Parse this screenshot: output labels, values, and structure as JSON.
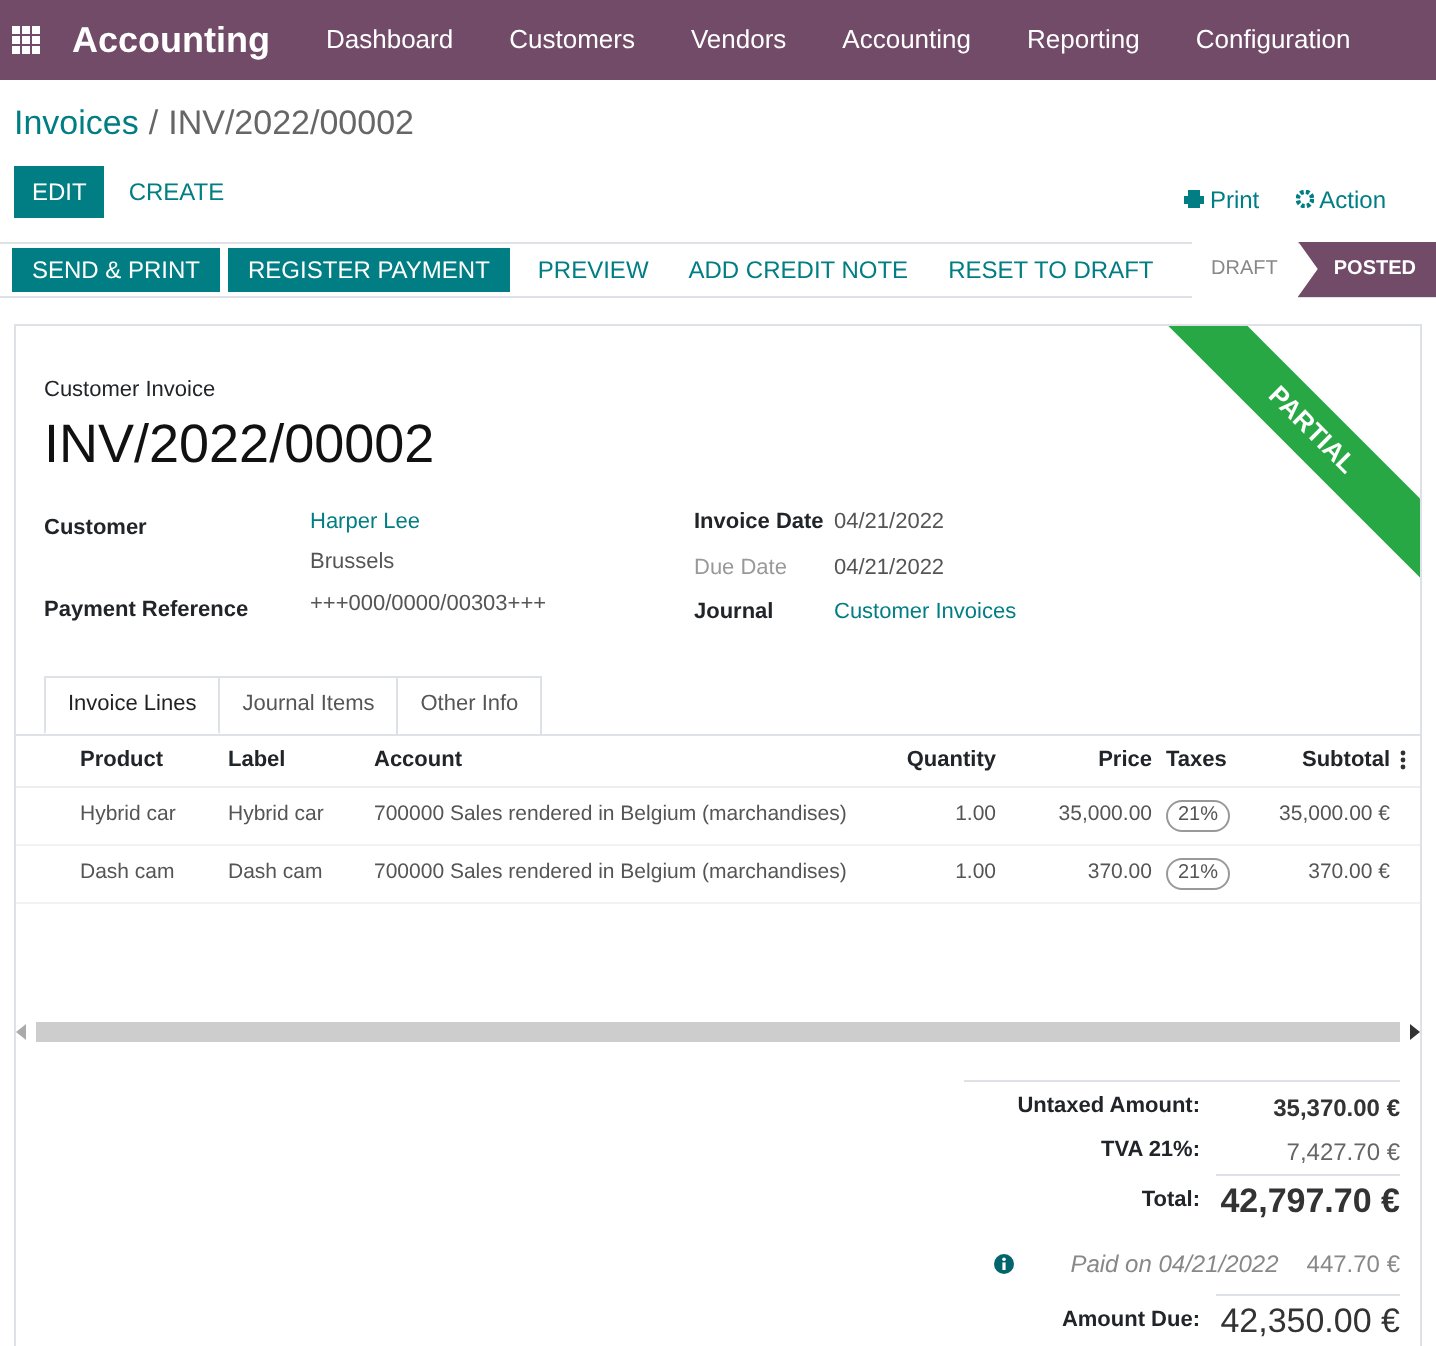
{
  "navbar": {
    "app_name": "Accounting",
    "menu": [
      "Dashboard",
      "Customers",
      "Vendors",
      "Accounting",
      "Reporting",
      "Configuration"
    ]
  },
  "breadcrumb": {
    "parent": "Invoices",
    "separator": "/",
    "current": "INV/2022/00002"
  },
  "control_buttons": [
    {
      "label": "EDIT",
      "kind": "primary"
    },
    {
      "label": "CREATE",
      "kind": "link"
    }
  ],
  "action_menus": [
    {
      "label": "Print",
      "kind": "print"
    },
    {
      "label": "Action",
      "kind": "action"
    }
  ],
  "header_buttons": [
    {
      "label": "SEND & PRINT",
      "kind": "primary"
    },
    {
      "label": "REGISTER PAYMENT",
      "kind": "primary"
    },
    {
      "label": "PREVIEW",
      "kind": "link"
    },
    {
      "label": "ADD CREDIT NOTE",
      "kind": "link"
    },
    {
      "label": "RESET TO DRAFT",
      "kind": "link"
    }
  ],
  "stages": [
    {
      "label": "DRAFT",
      "selected": false
    },
    {
      "label": "POSTED",
      "selected": true
    }
  ],
  "ribbon": "PARTIAL",
  "document_type": "Customer Invoice",
  "document_number": "INV/2022/00002",
  "left_fields": [
    {
      "label": "Customer",
      "values": [
        {
          "text": "Harper Lee",
          "kind": "link"
        },
        {
          "text": "Brussels",
          "kind": "plain"
        }
      ]
    },
    {
      "label": "Payment Reference",
      "values": [
        {
          "text": "+++000/0000/00303+++",
          "kind": "plain"
        }
      ]
    }
  ],
  "right_fields": [
    {
      "label": "Invoice Date",
      "muted": false,
      "value": "04/21/2022",
      "kind": "plain"
    },
    {
      "label": "Due Date",
      "muted": true,
      "value": "04/21/2022",
      "kind": "plain"
    },
    {
      "label": "Journal",
      "muted": false,
      "value": "Customer Invoices",
      "kind": "link"
    }
  ],
  "tabs": [
    {
      "label": "Invoice Lines",
      "selected": true
    },
    {
      "label": "Journal Items",
      "selected": false
    },
    {
      "label": "Other Info",
      "selected": false
    }
  ],
  "table": {
    "columns": [
      "Product",
      "Label",
      "Account",
      "Quantity",
      "Price",
      "Taxes",
      "Subtotal"
    ],
    "rows": [
      {
        "product": "Hybrid car",
        "label": "Hybrid car",
        "account": "700000 Sales rendered in Belgium (marchandises)",
        "quantity": "1.00",
        "price": "35,000.00",
        "tax": "21%",
        "subtotal": "35,000.00 €"
      },
      {
        "product": "Dash cam",
        "label": "Dash cam",
        "account": "700000 Sales rendered in Belgium (marchandises)",
        "quantity": "1.00",
        "price": "370.00",
        "tax": "21%",
        "subtotal": "370.00 €"
      }
    ]
  },
  "totals": {
    "untaxed_label": "Untaxed Amount:",
    "untaxed": "35,370.00 €",
    "tax_label": "TVA 21%:",
    "tax": "7,427.70 €",
    "total_label": "Total:",
    "total": "42,797.70 €",
    "payment": {
      "text": "Paid on 04/21/2022",
      "amount": "447.70 €"
    },
    "due_label": "Amount Due:",
    "due": "42,350.00 €"
  }
}
